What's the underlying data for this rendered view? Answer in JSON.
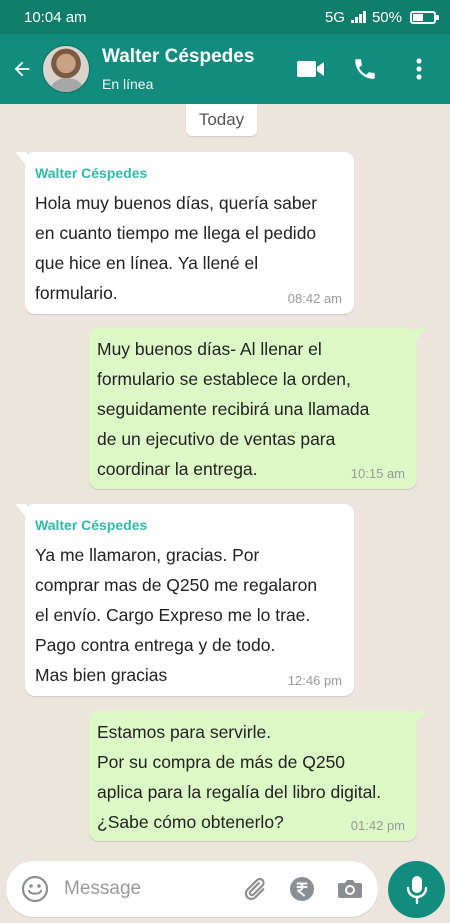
{
  "status_bar": {
    "time": "10:04 am",
    "network": "5G",
    "battery": "50%",
    "battery_level": 0.5
  },
  "header": {
    "contact_name": "Walter Céspedes",
    "contact_status": "En línea"
  },
  "chat": {
    "date_label": "Today",
    "messages": [
      {
        "direction": "in",
        "sender": "Walter Céspedes",
        "text": " Hola muy buenos días, quería saber\nen cuanto tiempo me llega el pedido\nque hice en línea. Ya llené el\nformulario.",
        "time": "08:42 am"
      },
      {
        "direction": "out",
        "text": " Muy buenos días- Al llenar el\nformulario se establece la orden,\nseguidamente recibirá una llamada\nde un ejecutivo de ventas para\ncoordinar la entrega.",
        "time": "10:15 am"
      },
      {
        "direction": "in",
        "sender": "Walter Céspedes",
        "text": " Ya me llamaron, gracias. Por\ncomprar mas de Q250 me regalaron\nel envío. Cargo Expreso me lo trae.\nPago contra entrega y de todo.\nMas bien gracias",
        "time": "12:46 pm"
      },
      {
        "direction": "out",
        "text": " Estamos para servirle.\nPor su compra de más de Q250\naplica para la regalía del libro digital.\n¿Sabe cómo obtenerlo?",
        "time": "01:42 pm"
      }
    ]
  },
  "composer": {
    "placeholder": "Message"
  },
  "colors": {
    "header": "#128c7e",
    "status_bar": "#0f7d6b",
    "outgoing_bubble": "#dcf8c6",
    "sender_name": "#34b7a7",
    "chat_background": "#ece5dd"
  },
  "icons": {
    "back": "back-arrow-icon",
    "video": "video-call-icon",
    "call": "phone-icon",
    "menu": "more-vert-icon",
    "emoji": "emoji-icon",
    "attach": "paperclip-icon",
    "payment": "rupee-icon",
    "camera": "camera-icon",
    "mic": "mic-icon"
  }
}
